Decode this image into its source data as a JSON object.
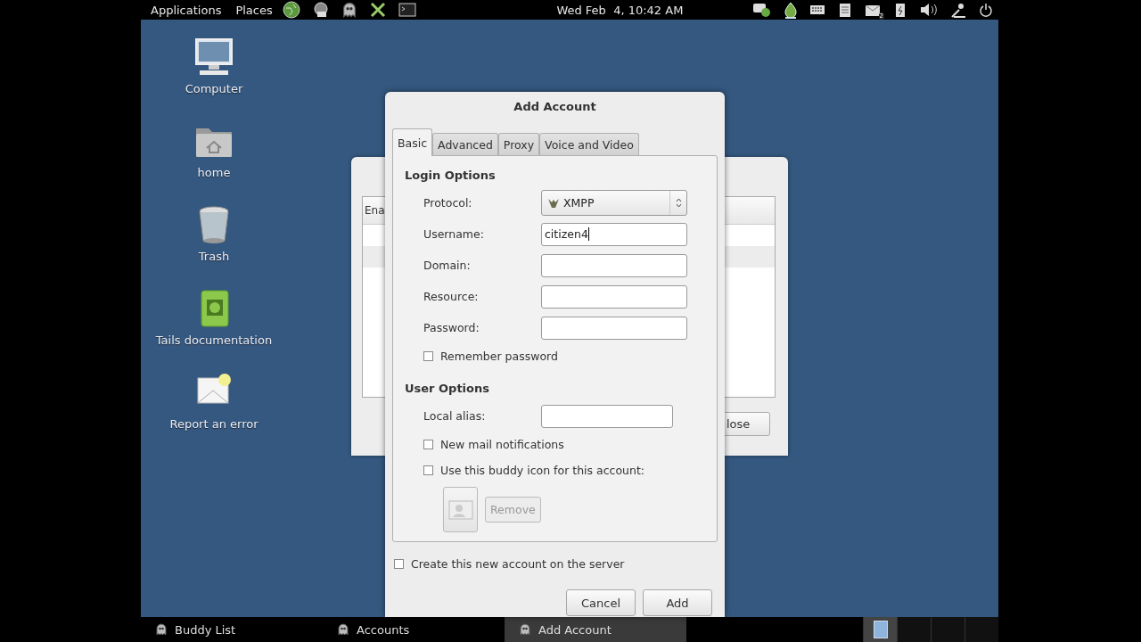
{
  "top_bar": {
    "menus": [
      "Applications",
      "Places"
    ],
    "clock": "Wed Feb  4, 10:42 AM",
    "mail_badge": "2"
  },
  "desktop_icons": [
    {
      "kind": "computer",
      "label": "Computer"
    },
    {
      "kind": "home",
      "label": "home"
    },
    {
      "kind": "trash",
      "label": "Trash"
    },
    {
      "kind": "book",
      "label": "Tails documentation"
    },
    {
      "kind": "mail",
      "label": "Report an error"
    }
  ],
  "background_window": {
    "column_header": "Ena",
    "button": "lose"
  },
  "dialog": {
    "title": "Add Account",
    "tabs": [
      {
        "label": "Basic",
        "selected": true
      },
      {
        "label": "Advanced",
        "selected": false
      },
      {
        "label": "Proxy",
        "selected": false
      },
      {
        "label": "Voice and Video",
        "selected": false
      }
    ],
    "sections": [
      {
        "heading": "Login Options",
        "rows": [
          {
            "kind": "select",
            "label": "Protocol:",
            "value": "XMPP"
          },
          {
            "kind": "text",
            "label": "Username:",
            "value": "citizen4",
            "focused": true
          },
          {
            "kind": "text",
            "label": "Domain:"
          },
          {
            "kind": "text",
            "label": "Resource:"
          },
          {
            "kind": "text",
            "label": "Password:"
          },
          {
            "kind": "check",
            "label": "Remember password",
            "checked": false
          }
        ]
      },
      {
        "heading": "User Options",
        "rows": [
          {
            "kind": "short-text",
            "label": "Local alias:"
          },
          {
            "kind": "check",
            "label": "New mail notifications",
            "checked": false
          },
          {
            "kind": "check",
            "label": "Use this buddy icon for this account:",
            "checked": false
          },
          {
            "kind": "icon-picker",
            "button": "Remove",
            "disabled": true
          }
        ]
      }
    ],
    "server_check": {
      "label": "Create this new account on the server",
      "checked": false
    },
    "buttons": [
      "Cancel",
      "Add"
    ]
  },
  "taskbar": {
    "items": [
      {
        "label": "Buddy List",
        "selected": false
      },
      {
        "label": "Accounts",
        "selected": false
      },
      {
        "label": "Add Account",
        "selected": true
      }
    ],
    "workspaces": [
      {
        "selected": true
      },
      {
        "selected": false
      },
      {
        "selected": false
      },
      {
        "selected": false
      }
    ]
  }
}
